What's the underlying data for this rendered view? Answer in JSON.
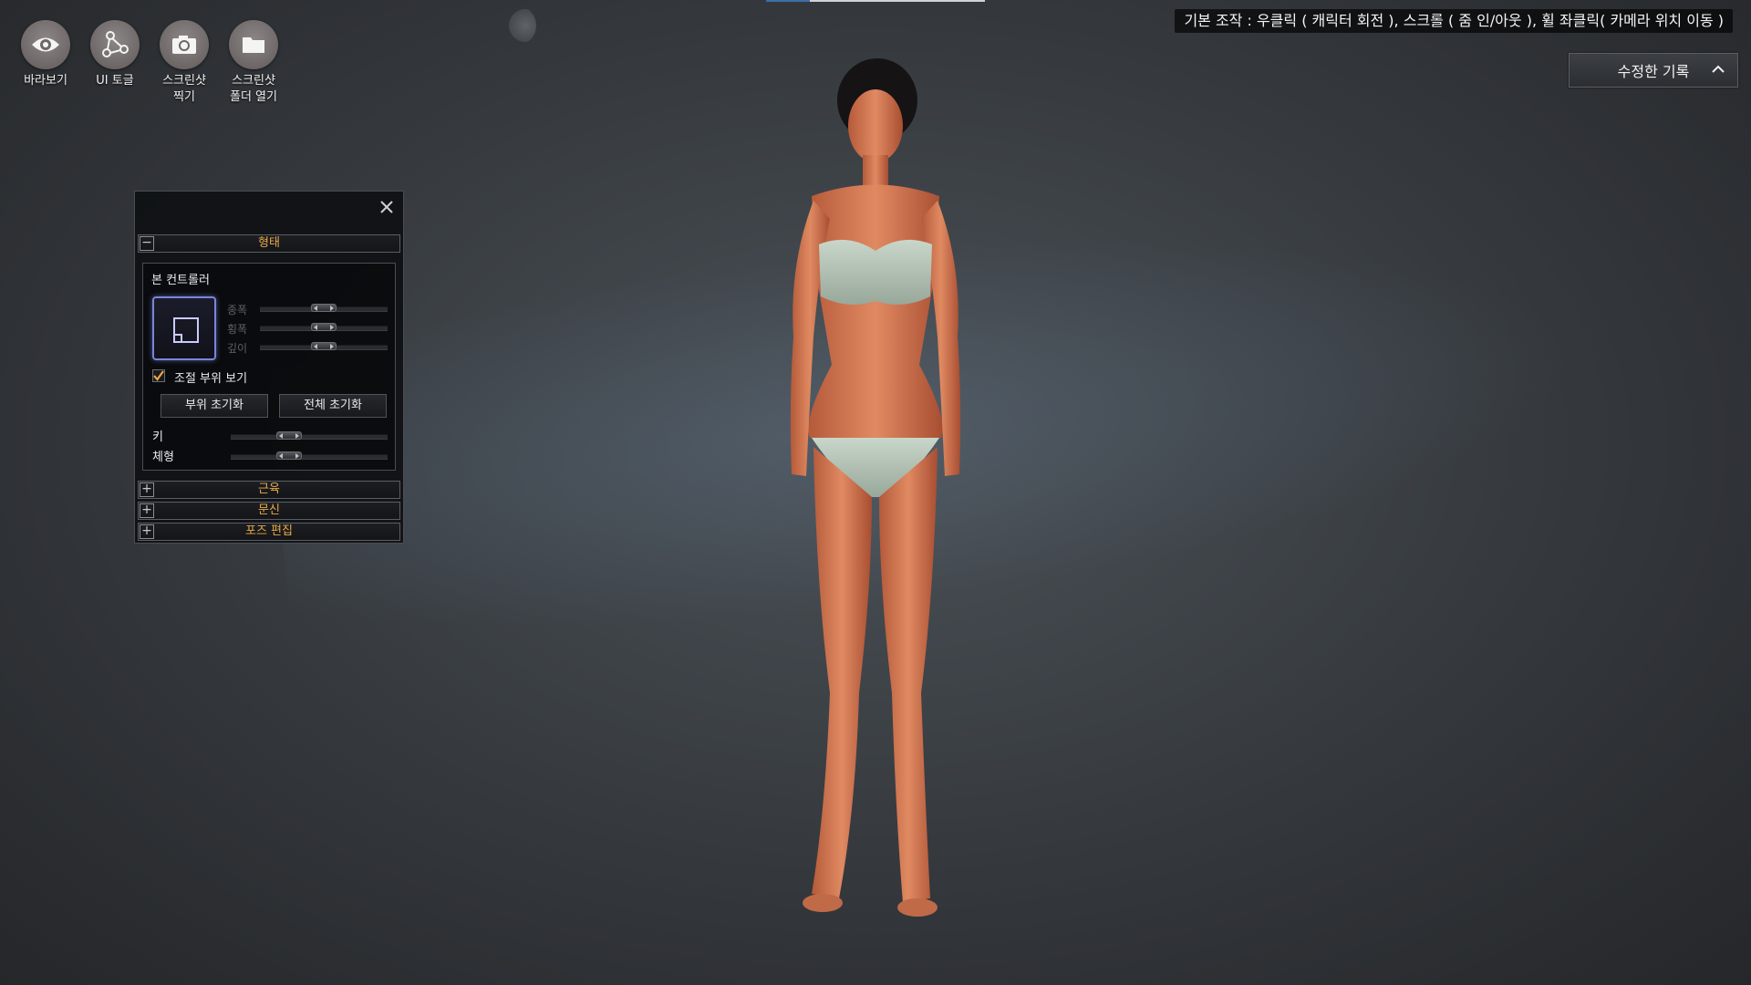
{
  "tools": [
    {
      "label": "바라보기",
      "icon": "eye-icon"
    },
    {
      "label": "UI 토글",
      "icon": "nodes-icon"
    },
    {
      "label": "스크린샷\n찍기",
      "icon": "camera-icon"
    },
    {
      "label": "스크린샷\n폴더 열기",
      "icon": "folder-icon"
    }
  ],
  "hint": "기본 조작 : 우클릭 ( 캐릭터 회전 ), 스크롤 ( 줌 인/아웃 ), 휠 좌클릭( 카메라 위치 이동 )",
  "history_button": "수정한 기록",
  "panel": {
    "section_shape": "형태",
    "bone_controller": "본 컨트롤러",
    "sliders": [
      {
        "label": "종폭",
        "value": 0.5
      },
      {
        "label": "횡폭",
        "value": 0.5
      },
      {
        "label": "깊이",
        "value": 0.5
      }
    ],
    "show_parts_label": "조절 부위 보기",
    "show_parts_checked": true,
    "reset_part": "부위 초기화",
    "reset_all": "전체 초기화",
    "height_label": "키",
    "height_value": 0.33,
    "body_label": "체형",
    "body_value": 0.33,
    "section_muscle": "근육",
    "section_tattoo": "문신",
    "section_pose": "포즈 편집"
  },
  "colors": {
    "accent_orange": "#e8a84a",
    "selection_blue": "#7a85d6"
  }
}
